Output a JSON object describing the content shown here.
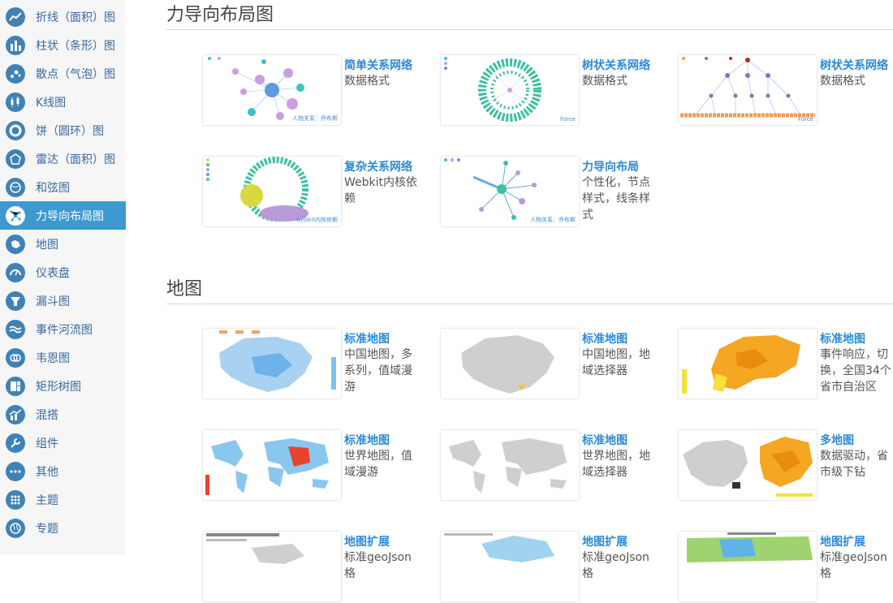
{
  "sidebar": {
    "items": [
      {
        "label": "折线（面积）图",
        "icon": "line-chart-icon"
      },
      {
        "label": "柱状（条形）图",
        "icon": "bar-chart-icon"
      },
      {
        "label": "散点（气泡）图",
        "icon": "scatter-chart-icon"
      },
      {
        "label": "K线图",
        "icon": "candlestick-chart-icon"
      },
      {
        "label": "饼（圆环）图",
        "icon": "pie-chart-icon"
      },
      {
        "label": "雷达（面积）图",
        "icon": "radar-chart-icon"
      },
      {
        "label": "和弦图",
        "icon": "chord-chart-icon"
      },
      {
        "label": "力导向布局图",
        "icon": "force-chart-icon",
        "active": true
      },
      {
        "label": "地图",
        "icon": "map-chart-icon"
      },
      {
        "label": "仪表盘",
        "icon": "gauge-chart-icon"
      },
      {
        "label": "漏斗图",
        "icon": "funnel-chart-icon"
      },
      {
        "label": "事件河流图",
        "icon": "event-river-icon"
      },
      {
        "label": "韦恩图",
        "icon": "venn-chart-icon"
      },
      {
        "label": "矩形树图",
        "icon": "treemap-chart-icon"
      },
      {
        "label": "混搭",
        "icon": "mix-chart-icon"
      },
      {
        "label": "组件",
        "icon": "component-icon"
      },
      {
        "label": "其他",
        "icon": "other-icon"
      },
      {
        "label": "主题",
        "icon": "theme-icon"
      },
      {
        "label": "专题",
        "icon": "topic-icon"
      }
    ]
  },
  "sections": {
    "force": {
      "title": "力导向布局图",
      "cards": [
        {
          "title": "简单关系网络",
          "desc": "数据格式",
          "thumb_label": "人物关系：乔布斯"
        },
        {
          "title": "树状关系网络",
          "desc": "数据格式",
          "thumb_label": "Force"
        },
        {
          "title": "树状关系网络",
          "desc": "数据格式",
          "thumb_label": "Force"
        },
        {
          "title": "复杂关系网络",
          "desc": "Webkit内核依赖",
          "thumb_label": "webkit内核依赖"
        },
        {
          "title": "力导向布局",
          "desc": "个性化，节点样式，线条样式",
          "thumb_label": "人物关系：乔布斯"
        }
      ]
    },
    "map": {
      "title": "地图",
      "cards": [
        {
          "title": "标准地图",
          "desc": "中国地图，多系列，值域漫游"
        },
        {
          "title": "标准地图",
          "desc": "中国地图，地域选择器"
        },
        {
          "title": "标准地图",
          "desc": "事件响应，切换，全国34个省市自治区"
        },
        {
          "title": "标准地图",
          "desc": "世界地图，值域漫游"
        },
        {
          "title": "标准地图",
          "desc": "世界地图，地域选择器"
        },
        {
          "title": "多地图",
          "desc": "数据驱动，省市级下钻"
        },
        {
          "title": "地图扩展",
          "desc": "标准geoJson格"
        },
        {
          "title": "地图扩展",
          "desc": "标准geoJson格"
        },
        {
          "title": "地图扩展",
          "desc": "标准geoJson格"
        }
      ]
    }
  }
}
